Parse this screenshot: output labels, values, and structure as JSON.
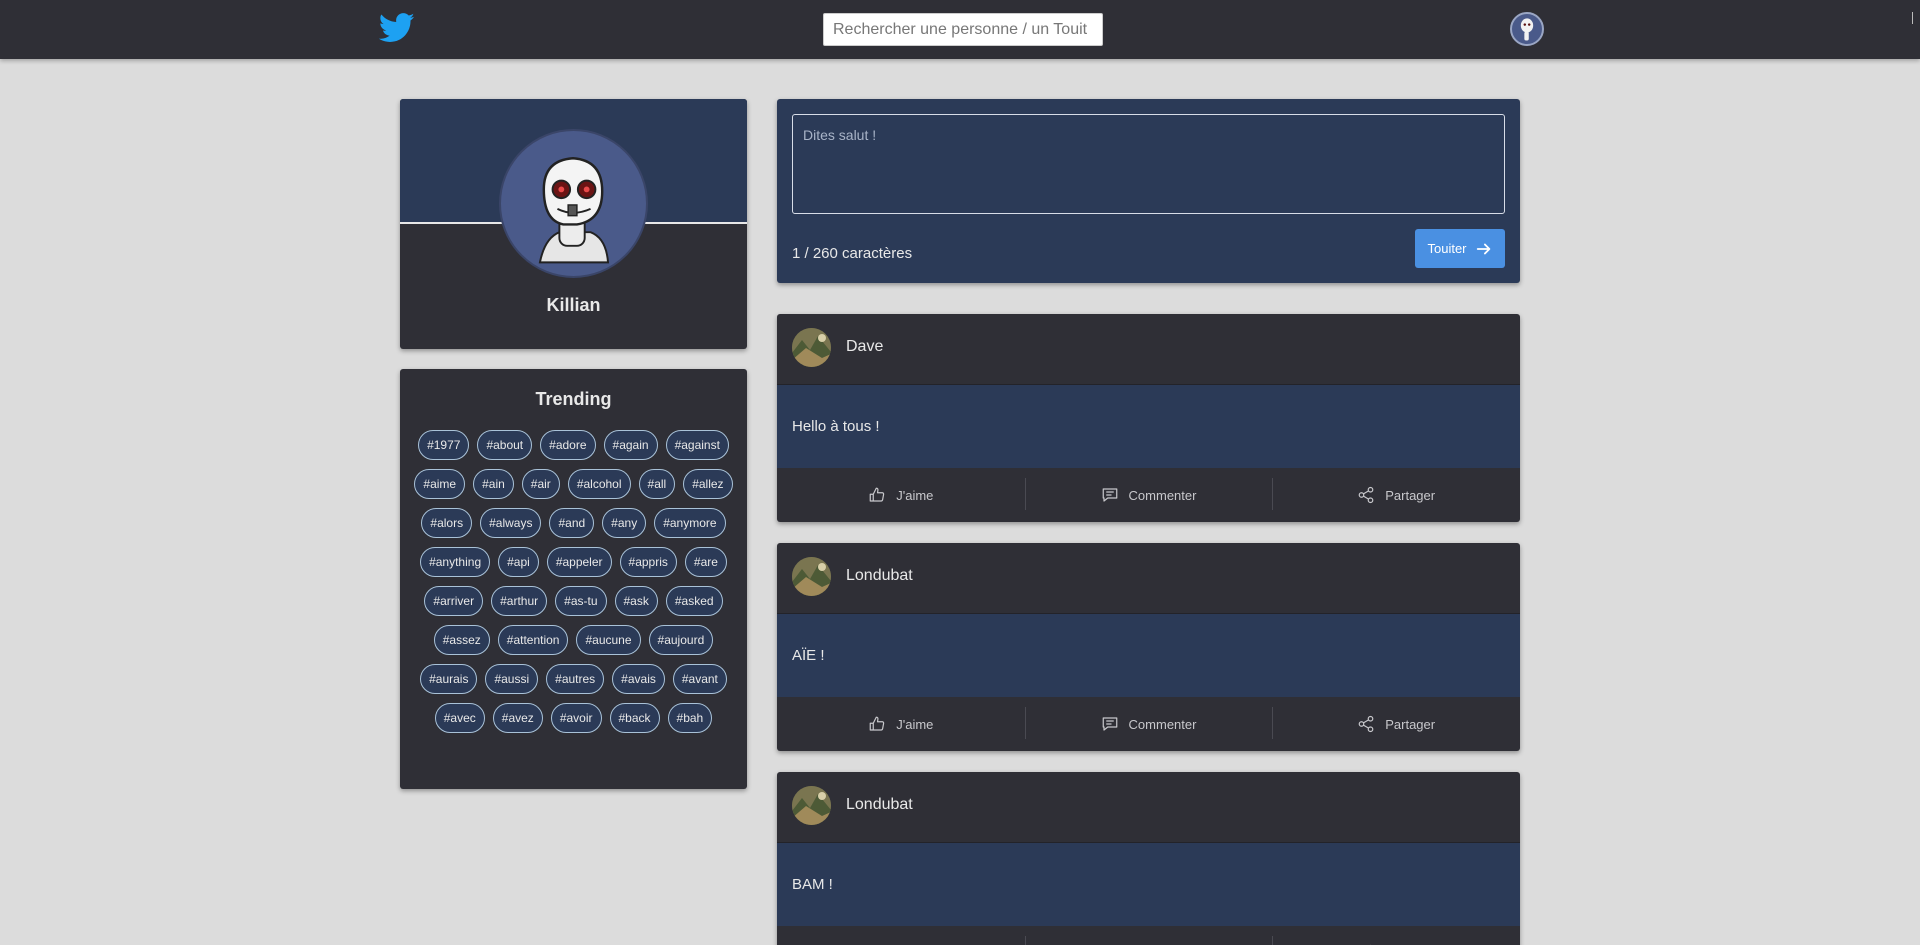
{
  "nav": {
    "logo_icon": "twitter-bird-icon",
    "search_placeholder": "Rechercher une personne / un Touit",
    "avatar_icon": "user-avatar-icon"
  },
  "profile": {
    "name": "Killian"
  },
  "trending": {
    "title": "Trending",
    "tags": [
      "#1977",
      "#about",
      "#adore",
      "#again",
      "#against",
      "#aime",
      "#ain",
      "#air",
      "#alcohol",
      "#all",
      "#allez",
      "#alors",
      "#always",
      "#and",
      "#any",
      "#anymore",
      "#anything",
      "#api",
      "#appeler",
      "#appris",
      "#are",
      "#arriver",
      "#arthur",
      "#as-tu",
      "#ask",
      "#asked",
      "#assez",
      "#attention",
      "#aucune",
      "#aujourd",
      "#aurais",
      "#aussi",
      "#autres",
      "#avais",
      "#avant",
      "#avec",
      "#avez",
      "#avoir",
      "#back",
      "#bah"
    ]
  },
  "compose": {
    "placeholder": "Dites salut !",
    "char_count": "1 / 260 caractères",
    "submit_label": "Touiter"
  },
  "actions": {
    "like": "J'aime",
    "comment": "Commenter",
    "share": "Partager"
  },
  "posts": [
    {
      "author": "Dave",
      "text": "Hello à tous !"
    },
    {
      "author": "Londubat",
      "text": "AÏE !"
    },
    {
      "author": "Londubat",
      "text": "BAM !"
    }
  ],
  "colors": {
    "page_bg": "#dcdcdc",
    "card_dark": "#2f2f36",
    "card_blue": "#2b3a57",
    "accent": "#4a90e2"
  }
}
